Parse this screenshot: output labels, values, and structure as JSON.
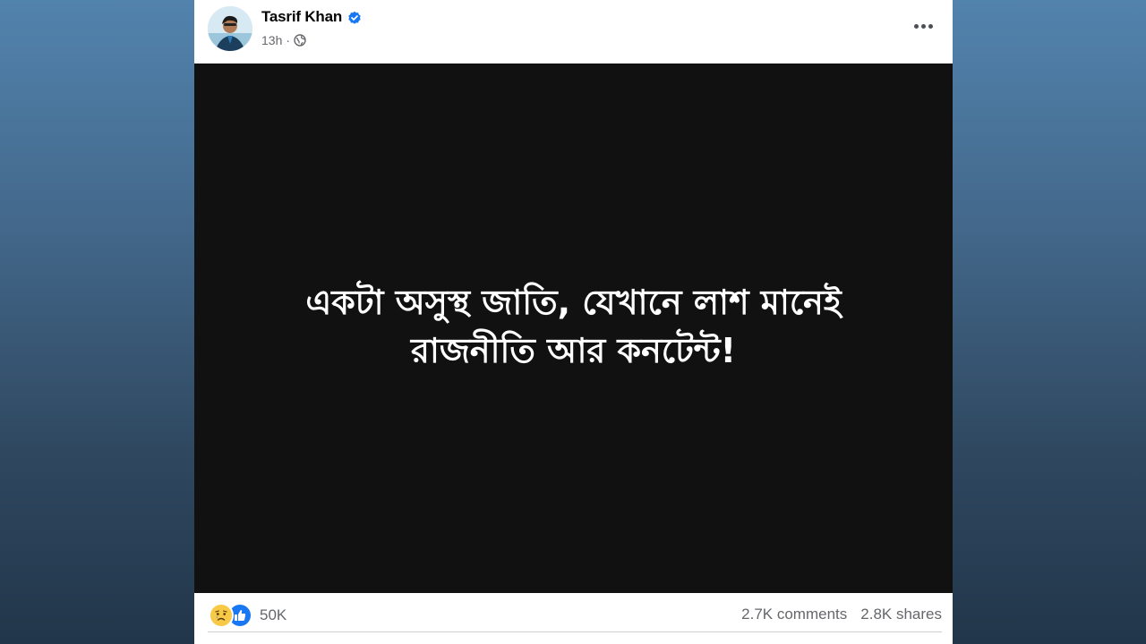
{
  "post": {
    "author": "Tasrif Khan",
    "time": "13h",
    "separator": "·",
    "media_text_line1": "একটা অসুস্থ জাতি, যেখানে লাশ মানেই",
    "media_text_line2": "রাজনীতি আর কনটেন্ট!"
  },
  "stats": {
    "reaction_count": "50K",
    "comments": "2.7K comments",
    "shares": "2.8K shares"
  },
  "icons": {
    "verified": "verified-badge-icon",
    "privacy": "globe-icon",
    "more": "more-options-icon",
    "reaction_1": "sad-reaction-icon",
    "reaction_2": "like-reaction-icon"
  },
  "colors": {
    "accent": "#1877f2",
    "media_background": "#111111",
    "secondary_text": "#65676b"
  }
}
